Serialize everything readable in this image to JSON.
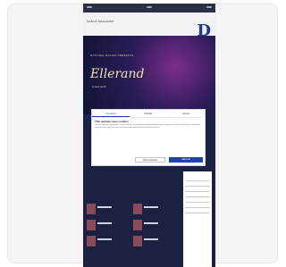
{
  "app": {
    "brand_small": "DANCE MAGAZINE",
    "brand_letter": "D"
  },
  "hero": {
    "tag": "NATIONAL BALLET PRESENTS",
    "title": "Ellerand",
    "subtitle": "A new work"
  },
  "cookie_modal": {
    "tabs": [
      "Consent",
      "Details",
      "About"
    ],
    "active_tab": "Consent",
    "title": "This website uses cookies",
    "body": "We use cookies to personalise content and ads, to provide social media features and to analyse our traffic. We also share information about your use of our site with our social media, advertising and analytics partners.",
    "buttons": {
      "allow_selection": "Allow selection",
      "allow_all": "Allow all"
    }
  }
}
